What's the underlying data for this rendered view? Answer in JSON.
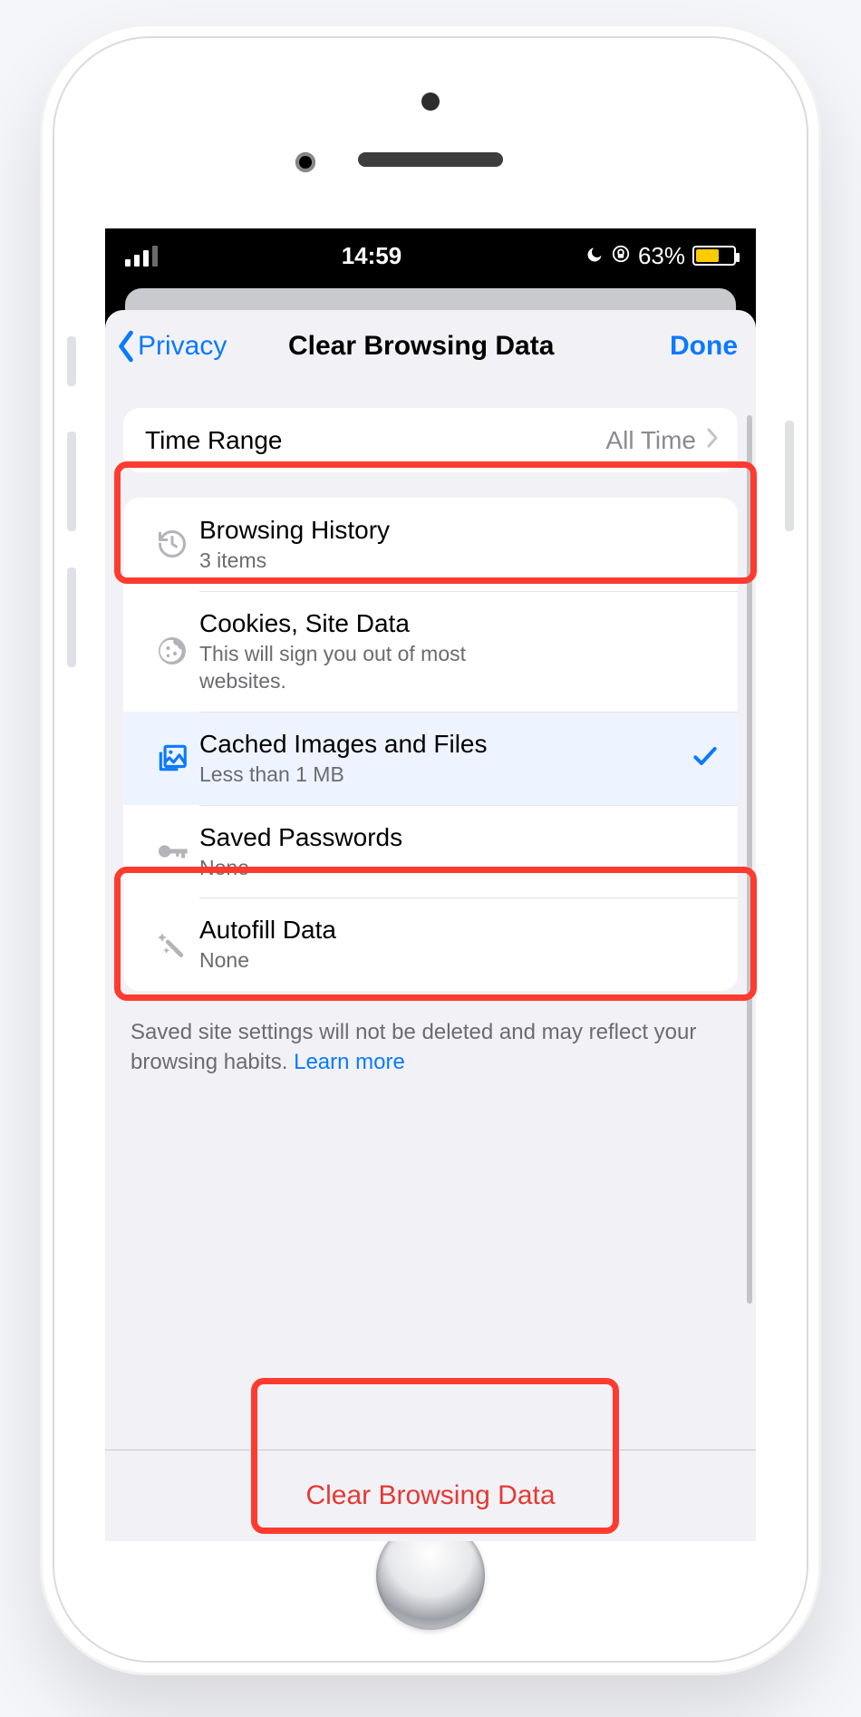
{
  "status": {
    "time": "14:59",
    "battery_pct": "63%"
  },
  "nav": {
    "back": "Privacy",
    "title": "Clear Browsing Data",
    "done": "Done"
  },
  "time_range": {
    "label": "Time Range",
    "value": "All Time"
  },
  "items": [
    {
      "title": "Browsing History",
      "sub": "3 items"
    },
    {
      "title": "Cookies, Site Data",
      "sub": "This will sign you out of most websites."
    },
    {
      "title": "Cached Images and Files",
      "sub": "Less than 1 MB"
    },
    {
      "title": "Saved Passwords",
      "sub": "None"
    },
    {
      "title": "Autofill Data",
      "sub": "None"
    }
  ],
  "footer": {
    "note": "Saved site settings will not be deleted and may reflect your browsing habits. ",
    "learn_more": "Learn more"
  },
  "clear_button": "Clear Browsing Data"
}
